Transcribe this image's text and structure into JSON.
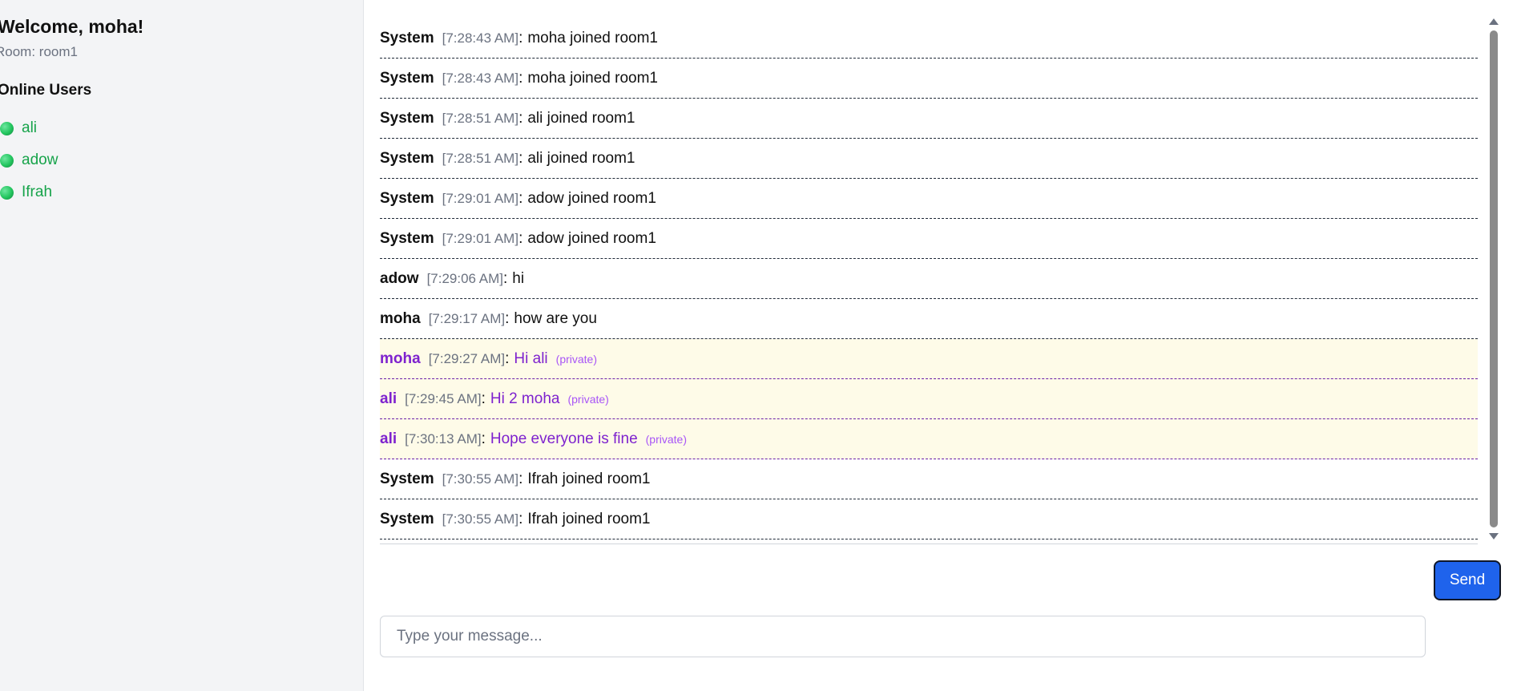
{
  "sidebar": {
    "welcome": "Welcome, moha!",
    "room": "Room: room1",
    "online_title": "Online Users",
    "users": [
      {
        "name": "ali"
      },
      {
        "name": "adow"
      },
      {
        "name": "Ifrah"
      }
    ]
  },
  "messages": [
    {
      "sender": "System",
      "time": "[7:28:43 AM]",
      "text": "moha joined room1",
      "private": false
    },
    {
      "sender": "System",
      "time": "[7:28:43 AM]",
      "text": "moha joined room1",
      "private": false
    },
    {
      "sender": "System",
      "time": "[7:28:51 AM]",
      "text": "ali joined room1",
      "private": false
    },
    {
      "sender": "System",
      "time": "[7:28:51 AM]",
      "text": "ali joined room1",
      "private": false
    },
    {
      "sender": "System",
      "time": "[7:29:01 AM]",
      "text": "adow joined room1",
      "private": false
    },
    {
      "sender": "System",
      "time": "[7:29:01 AM]",
      "text": "adow joined room1",
      "private": false
    },
    {
      "sender": "adow",
      "time": "[7:29:06 AM]",
      "text": "hi",
      "private": false
    },
    {
      "sender": "moha",
      "time": "[7:29:17 AM]",
      "text": "how are you",
      "private": false
    },
    {
      "sender": "moha",
      "time": "[7:29:27 AM]",
      "text": "Hi ali",
      "private": true,
      "tag": "(private)"
    },
    {
      "sender": "ali",
      "time": "[7:29:45 AM]",
      "text": "Hi 2 moha",
      "private": true,
      "tag": "(private)"
    },
    {
      "sender": "ali",
      "time": "[7:30:13 AM]",
      "text": "Hope everyone is fine",
      "private": true,
      "tag": "(private)"
    },
    {
      "sender": "System",
      "time": "[7:30:55 AM]",
      "text": "Ifrah joined room1",
      "private": false
    },
    {
      "sender": "System",
      "time": "[7:30:55 AM]",
      "text": "Ifrah joined room1",
      "private": false
    }
  ],
  "composer": {
    "send_label": "Send",
    "placeholder": "Type your message...",
    "value": ""
  },
  "colors": {
    "online": "#22c55e",
    "private_text": "#7e22ce",
    "private_bg": "#fefbe8",
    "send_button": "#1f63ec"
  },
  "icons": {
    "online_indicator": "online-dot-icon",
    "scroll_up": "scroll-up-icon",
    "scroll_down": "scroll-down-icon"
  }
}
